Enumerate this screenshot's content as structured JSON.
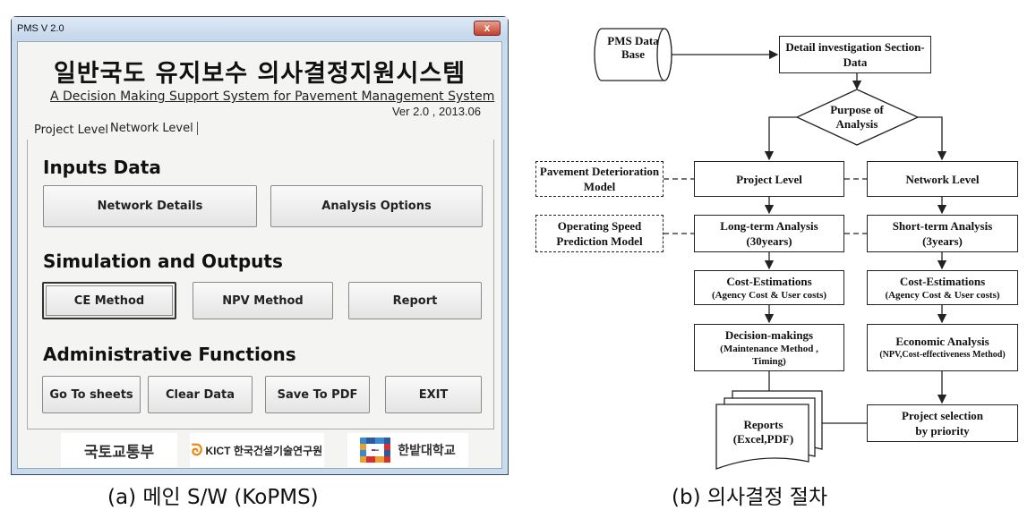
{
  "window": {
    "title": "PMS V 2.0",
    "close_icon": "close-icon",
    "close_label": "x"
  },
  "app": {
    "title_ko": "일반국도 유지보수 의사결정지원시스템",
    "subtitle": "A Decision Making Support System for Pavement Management System",
    "version": "Ver  2.0  ,  2013.06"
  },
  "tabs": [
    {
      "label": "Project Level"
    },
    {
      "label": "Network Level",
      "active": true
    }
  ],
  "sections": {
    "inputs": {
      "title": "Inputs Data",
      "buttons": [
        "Network Details",
        "Analysis Options"
      ]
    },
    "simulation": {
      "title": "Simulation and Outputs",
      "buttons": [
        "CE Method",
        "NPV Method",
        "Report"
      ]
    },
    "admin": {
      "title": "Administrative Functions",
      "buttons": [
        "Go To sheets",
        "Clear Data",
        "Save To PDF",
        "EXIT"
      ]
    }
  },
  "logos": [
    "국토교통부",
    "KICT 한국건설기술연구원",
    "한밭대학교"
  ],
  "captions": {
    "a": "(a) 메인 S/W (KoPMS)",
    "b": "(b) 의사결정 절차"
  },
  "flow": {
    "database": "PMS Data Base",
    "detail": "Detail investigation Section-Data",
    "decision": "Purpose of Analysis",
    "pavement_model": "Pavement Deterioration Model",
    "speed_model": "Operating Speed Prediction Model",
    "project_level": "Project Level",
    "network_level": "Network Level",
    "long_term": "Long-term Analysis",
    "long_term_sub": "(30years)",
    "short_term": "Short-term Analysis",
    "short_term_sub": "(3years)",
    "cost_left": "Cost-Estimations",
    "cost_left_sub": "(Agency Cost & User costs)",
    "cost_right": "Cost-Estimations",
    "cost_right_sub": "(Agency Cost & User costs)",
    "decision_making": "Decision-makings",
    "decision_making_sub": "(Maintenance Method , Timing)",
    "economic": "Economic Analysis",
    "economic_sub": "(NPV,Cost-effectiveness Method)",
    "reports": "Reports (Excel,PDF)",
    "project_selection": "Project selection by priority"
  }
}
